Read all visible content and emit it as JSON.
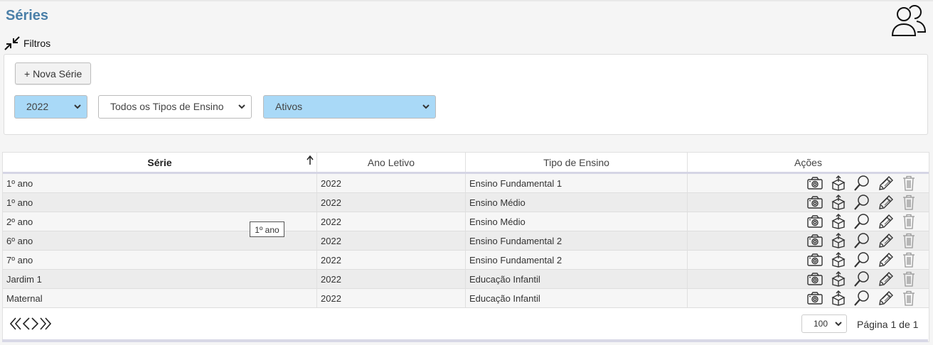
{
  "page": {
    "title": "Séries"
  },
  "header": {
    "user_icon": "users-icon"
  },
  "filters": {
    "toggle_label": "Filtros",
    "new_button_label": "+ Nova Série",
    "year_select": {
      "value": "2022"
    },
    "type_select": {
      "value": "Todos os Tipos de Ensino"
    },
    "status_select": {
      "value": "Ativos"
    }
  },
  "table": {
    "columns": [
      "Série",
      "Ano Letivo",
      "Tipo de Ensino",
      "Ações"
    ],
    "sorted_column": "Série",
    "rows": [
      [
        "1º ano",
        "2022",
        "Ensino Fundamental 1"
      ],
      [
        "1º ano",
        "2022",
        "Ensino Médio"
      ],
      [
        "2º ano",
        "2022",
        "Ensino Médio"
      ],
      [
        "6º ano",
        "2022",
        "Ensino Fundamental 2"
      ],
      [
        "7º ano",
        "2022",
        "Ensino Fundamental 2"
      ],
      [
        "Jardim 1",
        "2022",
        "Educação Infantil"
      ],
      [
        "Maternal",
        "2022",
        "Educação Infantil"
      ]
    ],
    "action_icons": [
      "camera-icon",
      "box-icon",
      "search-icon",
      "pencil-icon",
      "trash-icon"
    ]
  },
  "tooltip": {
    "text": "1º ano"
  },
  "pagination": {
    "page_size": "100",
    "page_info": "Página 1 de 1"
  },
  "colors": {
    "title": "#4a7fa8",
    "select_highlight": "#a9d9f7"
  }
}
